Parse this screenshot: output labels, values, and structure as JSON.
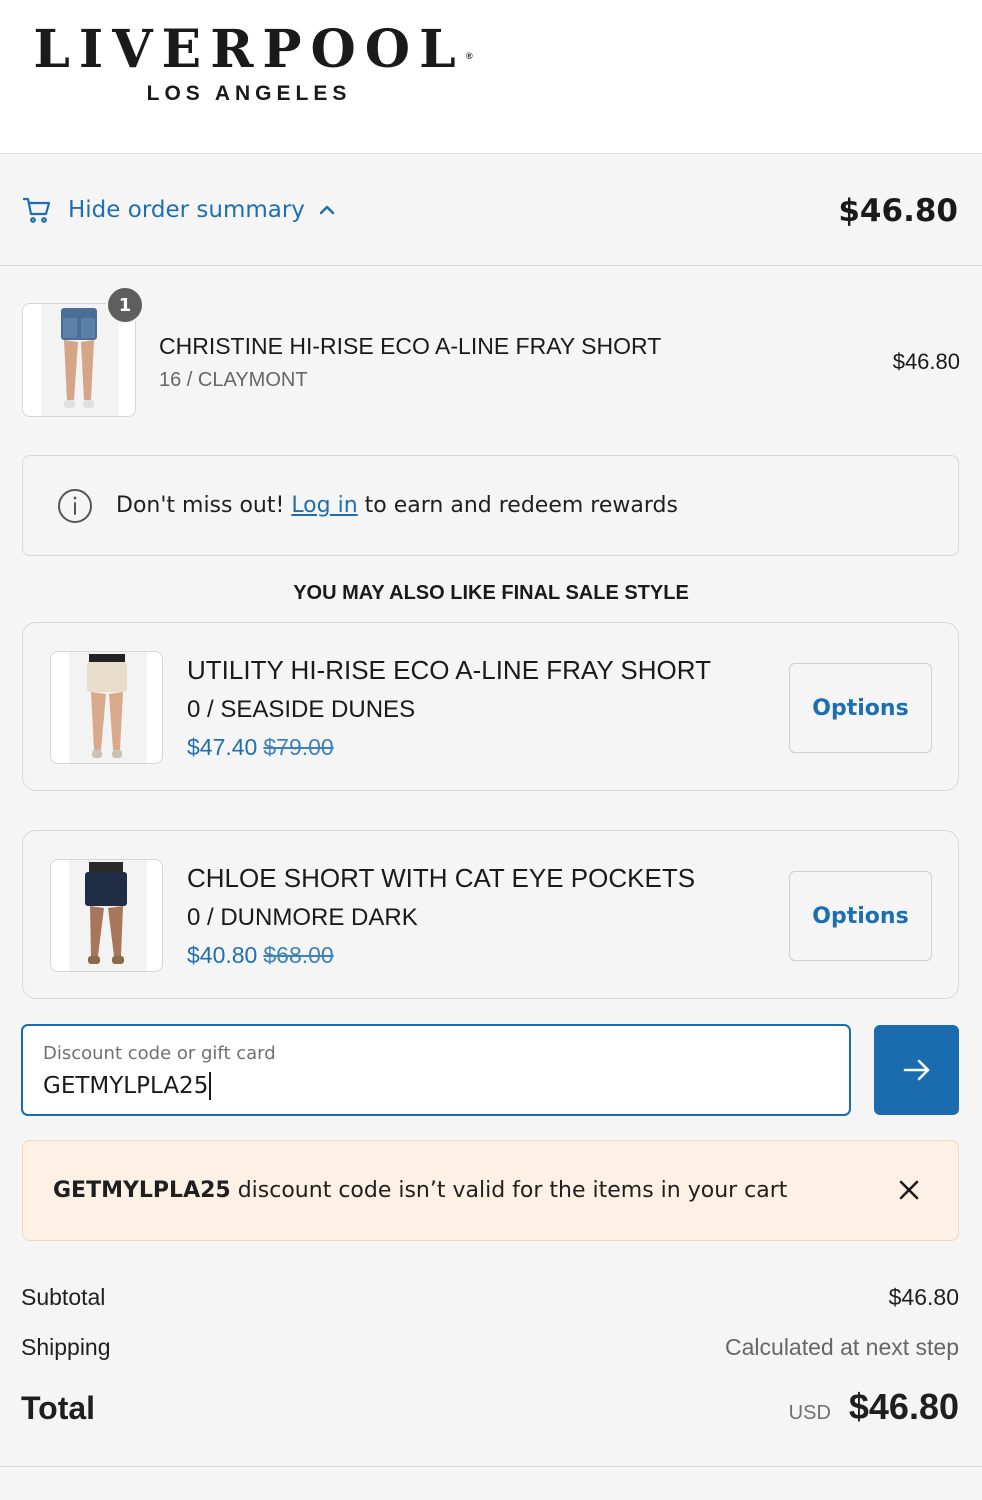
{
  "brand": {
    "name": "LIVERPOOL",
    "registered": "®",
    "subtitle": "LOS ANGELES"
  },
  "summary": {
    "toggle_label": "Hide order summary",
    "total": "$46.80"
  },
  "line_item": {
    "quantity": "1",
    "name": "CHRISTINE HI-RISE ECO A-LINE FRAY SHORT",
    "variant": "16 / CLAYMONT",
    "price": "$46.80"
  },
  "rewards": {
    "prefix": "Don't miss out! ",
    "link": "Log in",
    "suffix": " to earn and redeem rewards"
  },
  "upsell": {
    "heading": "YOU MAY ALSO LIKE FINAL SALE STYLE",
    "items": [
      {
        "name": "UTILITY HI-RISE ECO A-LINE FRAY SHORT",
        "variant": "0 / SEASIDE DUNES",
        "price": "$47.40",
        "compare_at": "$79.00",
        "button": "Options"
      },
      {
        "name": "CHLOE SHORT WITH CAT EYE POCKETS",
        "variant": "0 / DUNMORE DARK",
        "price": "$40.80",
        "compare_at": "$68.00",
        "button": "Options"
      }
    ]
  },
  "discount": {
    "label": "Discount code or gift card",
    "value": "GETMYLPLA25"
  },
  "error": {
    "code": "GETMYLPLA25",
    "message": " discount code isn’t valid for the items in your cart"
  },
  "totals": {
    "subtotal_label": "Subtotal",
    "subtotal_value": "$46.80",
    "shipping_label": "Shipping",
    "shipping_value": "Calculated at next step",
    "total_label": "Total",
    "currency": "USD",
    "total_value": "$46.80"
  },
  "colors": {
    "accent": "#1f6fb0",
    "button": "#1a6cae",
    "error_bg": "#fdf1e5",
    "background": "#f5f5f5"
  },
  "icons": [
    "cart-icon",
    "chevron-up-icon",
    "info-icon",
    "arrow-right-icon",
    "close-icon"
  ]
}
